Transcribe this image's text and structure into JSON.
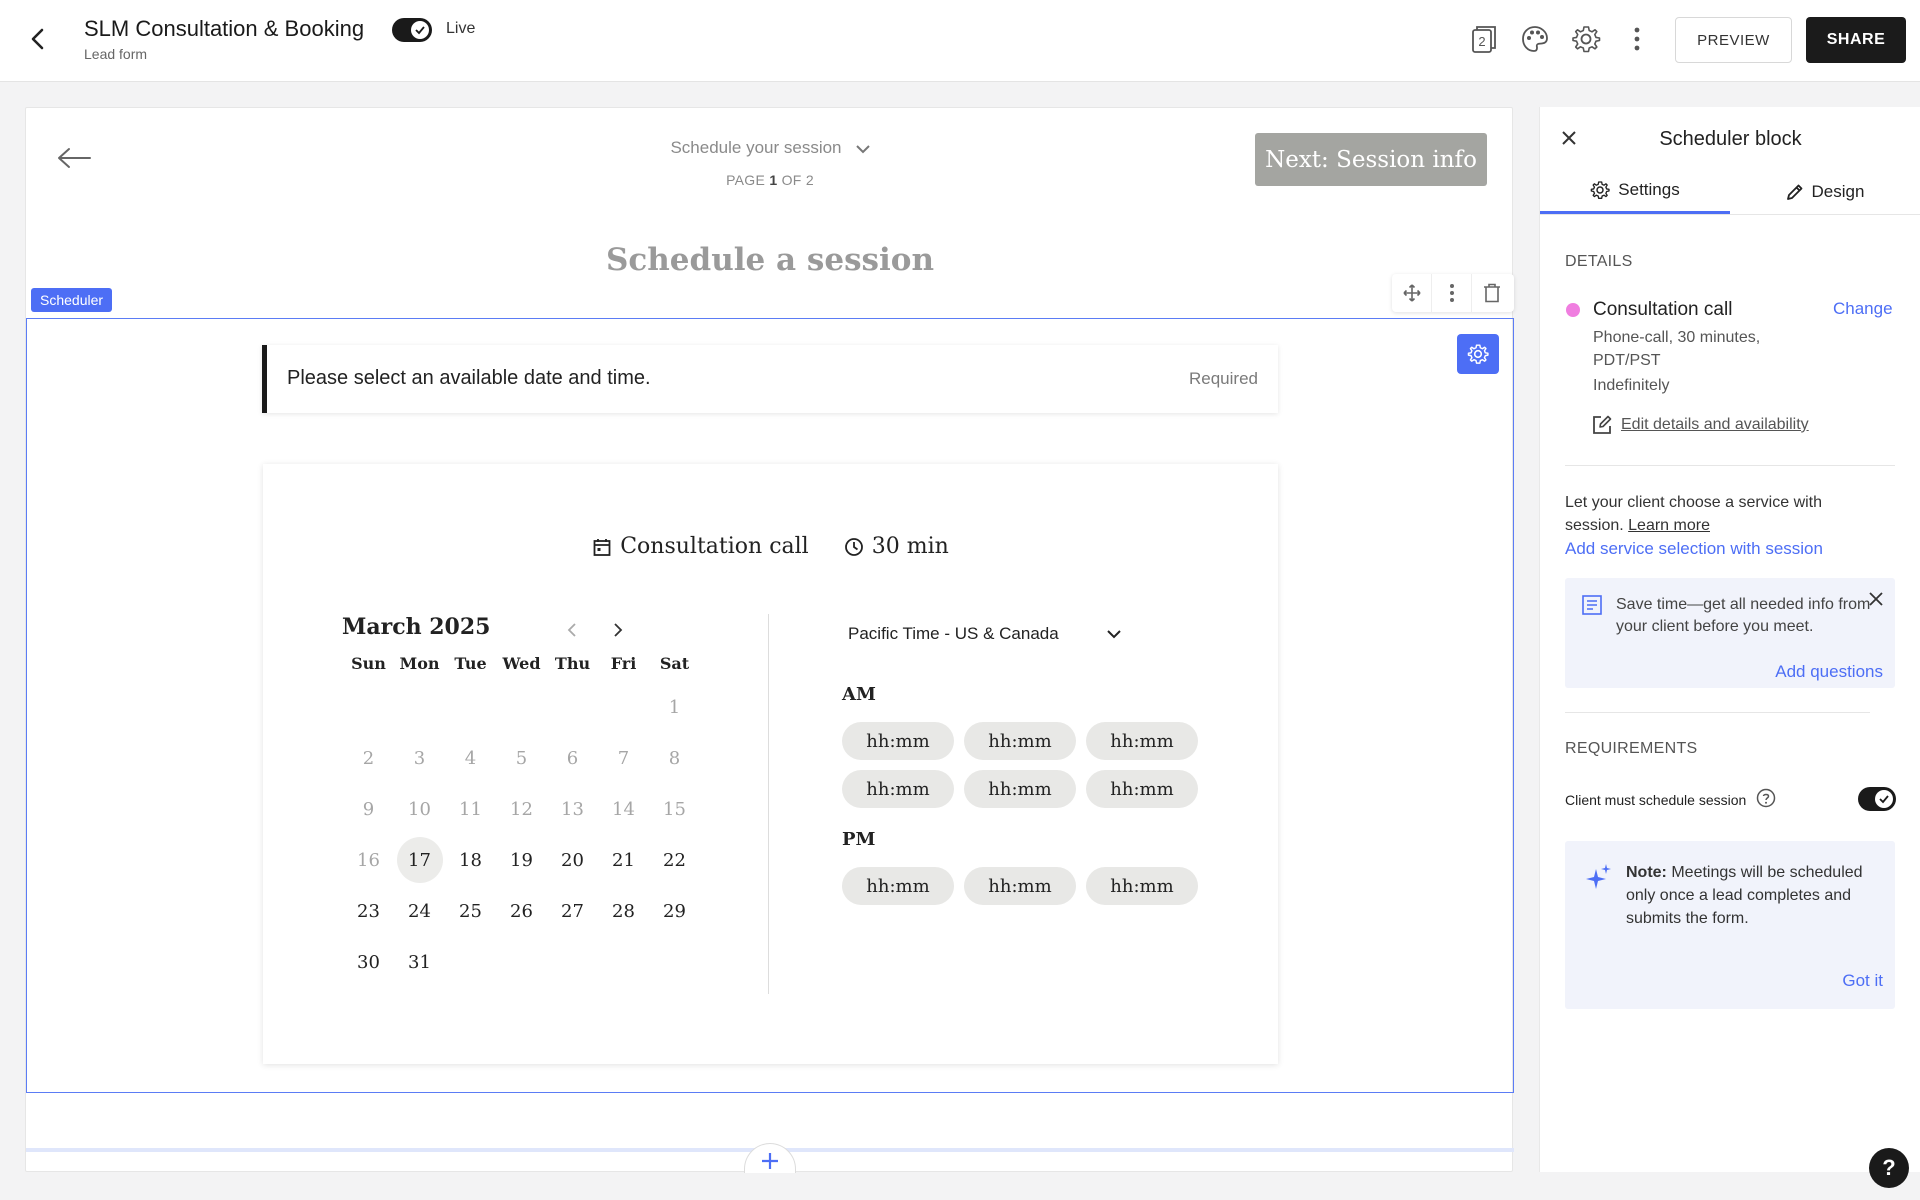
{
  "header": {
    "title": "SLM Consultation & Booking",
    "subtitle": "Lead form",
    "live_label": "Live",
    "pages_badge": "2",
    "preview_label": "PREVIEW",
    "share_label": "SHARE"
  },
  "canvas": {
    "page_name": "Schedule your session",
    "page_prefix": "PAGE ",
    "page_current": "1",
    "page_suffix": " OF 2",
    "next_button": "Next: Session info",
    "section_title": "Schedule a session",
    "block_tag": "Scheduler",
    "question": {
      "text": "Please select an available date and time.",
      "required": "Required"
    },
    "scheduler": {
      "service": "Consultation call",
      "duration": "30 min",
      "month": "March 2025",
      "weekdays": [
        "Sun",
        "Mon",
        "Tue",
        "Wed",
        "Thu",
        "Fri",
        "Sat"
      ],
      "days": [
        {
          "d": "",
          "s": "empty"
        },
        {
          "d": "",
          "s": "empty"
        },
        {
          "d": "",
          "s": "empty"
        },
        {
          "d": "",
          "s": "empty"
        },
        {
          "d": "",
          "s": "empty"
        },
        {
          "d": "",
          "s": "empty"
        },
        {
          "d": "1",
          "s": "dim"
        },
        {
          "d": "2",
          "s": "dim"
        },
        {
          "d": "3",
          "s": "dim"
        },
        {
          "d": "4",
          "s": "dim"
        },
        {
          "d": "5",
          "s": "dim"
        },
        {
          "d": "6",
          "s": "dim"
        },
        {
          "d": "7",
          "s": "dim"
        },
        {
          "d": "8",
          "s": "dim"
        },
        {
          "d": "9",
          "s": "dim"
        },
        {
          "d": "10",
          "s": "dim"
        },
        {
          "d": "11",
          "s": "dim"
        },
        {
          "d": "12",
          "s": "dim"
        },
        {
          "d": "13",
          "s": "dim"
        },
        {
          "d": "14",
          "s": "dim"
        },
        {
          "d": "15",
          "s": "dim"
        },
        {
          "d": "16",
          "s": "dim"
        },
        {
          "d": "17",
          "s": "sel"
        },
        {
          "d": "18",
          "s": ""
        },
        {
          "d": "19",
          "s": ""
        },
        {
          "d": "20",
          "s": ""
        },
        {
          "d": "21",
          "s": ""
        },
        {
          "d": "22",
          "s": ""
        },
        {
          "d": "23",
          "s": ""
        },
        {
          "d": "24",
          "s": ""
        },
        {
          "d": "25",
          "s": ""
        },
        {
          "d": "26",
          "s": ""
        },
        {
          "d": "27",
          "s": ""
        },
        {
          "d": "28",
          "s": ""
        },
        {
          "d": "29",
          "s": ""
        },
        {
          "d": "30",
          "s": ""
        },
        {
          "d": "31",
          "s": ""
        }
      ],
      "timezone": "Pacific Time - US & Canada",
      "am_label": "AM",
      "pm_label": "PM",
      "am_slots": [
        "hh:mm",
        "hh:mm",
        "hh:mm",
        "hh:mm",
        "hh:mm",
        "hh:mm"
      ],
      "pm_slots": [
        "hh:mm",
        "hh:mm",
        "hh:mm"
      ]
    }
  },
  "panel": {
    "title": "Scheduler block",
    "tabs": [
      {
        "label": "Settings"
      },
      {
        "label": "Design"
      }
    ],
    "details_label": "DETAILS",
    "service_name": "Consultation call",
    "change_label": "Change",
    "service_meta_1": "Phone-call, 30 minutes,",
    "service_meta_2": "PDT/PST",
    "service_meta_3": "Indefinitely",
    "edit_link": "Edit details and availability",
    "choose_text": "Let your client choose a service with session.",
    "learn_more": "Learn more",
    "add_service_link": "Add service selection with session",
    "tip_text": "Save time—get all needed info from your client before you meet.",
    "tip_link": "Add questions",
    "requirements_label": "REQUIREMENTS",
    "requirement_text": "Client must schedule session",
    "note_bold": "Note:",
    "note_text": " Meetings will be scheduled only once a lead completes and submits the form.",
    "note_link": "Got it"
  },
  "help_label": "?",
  "colors": {
    "accent": "#4d6ef5",
    "dark": "#1b1b1b",
    "next_button_bg": "#a4a5a1",
    "service_dot": "#f07ee0",
    "tip_bg": "#f1f3fb"
  }
}
